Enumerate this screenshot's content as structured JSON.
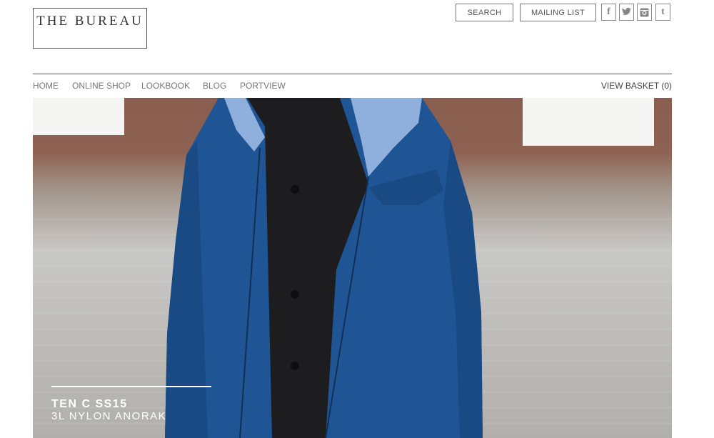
{
  "header": {
    "logo_text": "THE BUREAU",
    "search_label": "SEARCH",
    "mailing_label": "MAILING LIST",
    "social": {
      "facebook": "f",
      "twitter": "🐦",
      "instagram": "◙",
      "tumblr": "t"
    }
  },
  "nav": {
    "items": [
      {
        "label": "HOME"
      },
      {
        "label": "ONLINE SHOP"
      },
      {
        "label": "LOOKBOOK"
      },
      {
        "label": "BLOG"
      },
      {
        "label": "PORTVIEW"
      }
    ],
    "basket_label": "VIEW BASKET (0)"
  },
  "hero": {
    "title": "TEN C SS15",
    "subtitle": "3L NYLON ANORAK"
  },
  "colors": {
    "jacket": "#1f5595",
    "shirt": "#1d1d1f",
    "lining": "#8fb0dc",
    "brick": "#8a5e4e",
    "floor": "#bdbcb9"
  }
}
